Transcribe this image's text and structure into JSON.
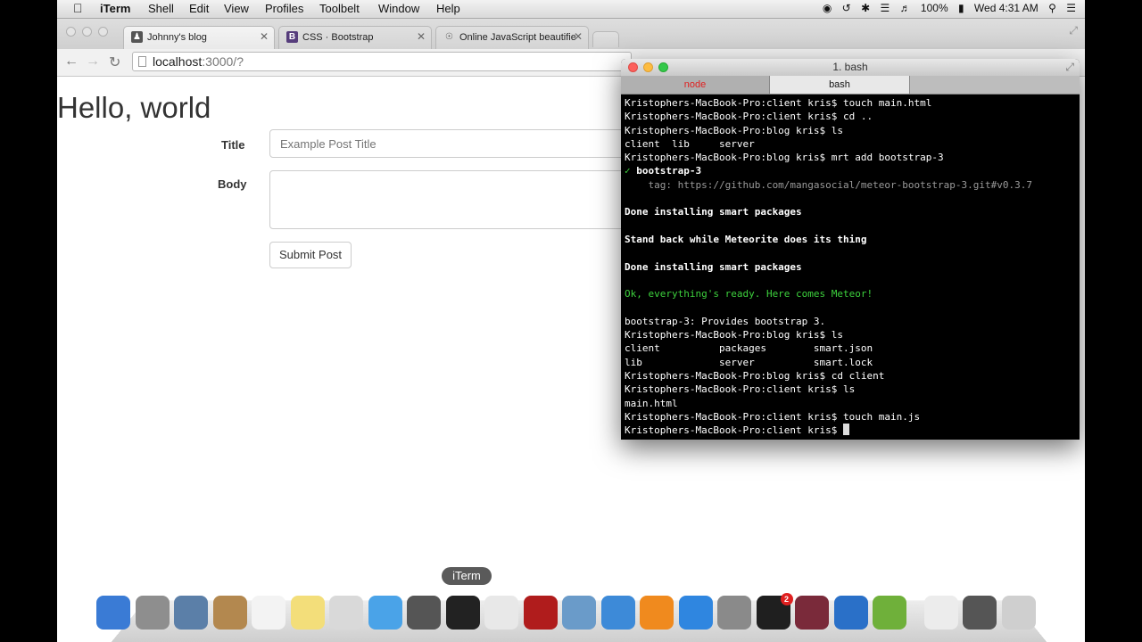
{
  "menubar": {
    "apple_icon": "apple-logo-icon",
    "app_name": "iTerm",
    "items": [
      "Shell",
      "Edit",
      "View",
      "Profiles",
      "Toolbelt",
      "Window",
      "Help"
    ],
    "battery": "100%",
    "clock": "Wed 4:31 AM"
  },
  "browser": {
    "tabs": [
      {
        "label": "Johnny's blog"
      },
      {
        "label": "CSS · Bootstrap"
      },
      {
        "label": "Online JavaScript beautifier"
      }
    ],
    "url_host": "localhost",
    "url_rest": ":3000/?",
    "page": {
      "heading": "Hello, world",
      "title_label": "Title",
      "title_placeholder": "Example Post Title",
      "body_label": "Body",
      "submit_label": "Submit Post"
    }
  },
  "iterm": {
    "window_title": "1. bash",
    "tabs": [
      "node",
      "bash"
    ],
    "lines": [
      {
        "text": "Kristophers-MacBook-Pro:client kris$ touch main.html",
        "style": ""
      },
      {
        "text": "Kristophers-MacBook-Pro:client kris$ cd ..",
        "style": ""
      },
      {
        "text": "Kristophers-MacBook-Pro:blog kris$ ls",
        "style": ""
      },
      {
        "text": "client  lib     server",
        "style": ""
      },
      {
        "text": "Kristophers-MacBook-Pro:blog kris$ mrt add bootstrap-3",
        "style": ""
      },
      {
        "text": "✓ bootstrap-3",
        "style": "check"
      },
      {
        "text": "    tag: https://github.com/mangasocial/meteor-bootstrap-3.git#v0.3.7",
        "style": "gray"
      },
      {
        "text": "",
        "style": ""
      },
      {
        "text": "Done installing smart packages",
        "style": "bold"
      },
      {
        "text": "",
        "style": ""
      },
      {
        "text": "Stand back while Meteorite does its thing",
        "style": "bold"
      },
      {
        "text": "",
        "style": ""
      },
      {
        "text": "Done installing smart packages",
        "style": "bold"
      },
      {
        "text": "",
        "style": ""
      },
      {
        "text": "Ok, everything's ready. Here comes Meteor!",
        "style": "green"
      },
      {
        "text": "",
        "style": ""
      },
      {
        "text": "bootstrap-3: Provides bootstrap 3.",
        "style": ""
      },
      {
        "text": "Kristophers-MacBook-Pro:blog kris$ ls",
        "style": ""
      },
      {
        "text": "client          packages        smart.json",
        "style": ""
      },
      {
        "text": "lib             server          smart.lock",
        "style": ""
      },
      {
        "text": "Kristophers-MacBook-Pro:blog kris$ cd client",
        "style": ""
      },
      {
        "text": "Kristophers-MacBook-Pro:client kris$ ls",
        "style": ""
      },
      {
        "text": "main.html",
        "style": ""
      },
      {
        "text": "Kristophers-MacBook-Pro:client kris$ touch main.js",
        "style": ""
      },
      {
        "text": "Kristophers-MacBook-Pro:client kris$ ",
        "style": "cursor"
      }
    ]
  },
  "dock": {
    "tooltip": "iTerm",
    "spotify_badge": "2",
    "icons": [
      {
        "name": "finder-icon",
        "color": "#3a7bd5"
      },
      {
        "name": "launchpad-icon",
        "color": "#8e8e8e"
      },
      {
        "name": "mail-stamp-icon",
        "color": "#5b7fa8"
      },
      {
        "name": "contacts-icon",
        "color": "#b3884f"
      },
      {
        "name": "calendar-icon",
        "color": "#f3f3f3"
      },
      {
        "name": "notes-icon",
        "color": "#f3de7a"
      },
      {
        "name": "preview-icon",
        "color": "#d9d9d9"
      },
      {
        "name": "messages-icon",
        "color": "#4aa3e8"
      },
      {
        "name": "facetime-icon",
        "color": "#555555"
      },
      {
        "name": "iterm-icon",
        "color": "#222222"
      },
      {
        "name": "chrome-icon",
        "color": "#e8e8e8"
      },
      {
        "name": "photo-booth-icon",
        "color": "#b01c1c"
      },
      {
        "name": "iphoto-icon",
        "color": "#6a9bc9"
      },
      {
        "name": "itunes-icon",
        "color": "#3d8ad8"
      },
      {
        "name": "ibooks-icon",
        "color": "#f08a1e"
      },
      {
        "name": "app-store-icon",
        "color": "#2f86e0"
      },
      {
        "name": "system-preferences-icon",
        "color": "#8a8a8a"
      },
      {
        "name": "spotify-icon",
        "color": "#1f1f1f"
      },
      {
        "name": "textmate-icon",
        "color": "#7a2a3a"
      },
      {
        "name": "quicktime-icon",
        "color": "#2a70c8"
      },
      {
        "name": "filemerge-icon",
        "color": "#6fb03a"
      },
      {
        "name": "log-document-icon",
        "color": "#ececec"
      },
      {
        "name": "downloads-stack-icon",
        "color": "#555555"
      },
      {
        "name": "trash-icon",
        "color": "#cfcfcf"
      }
    ]
  }
}
